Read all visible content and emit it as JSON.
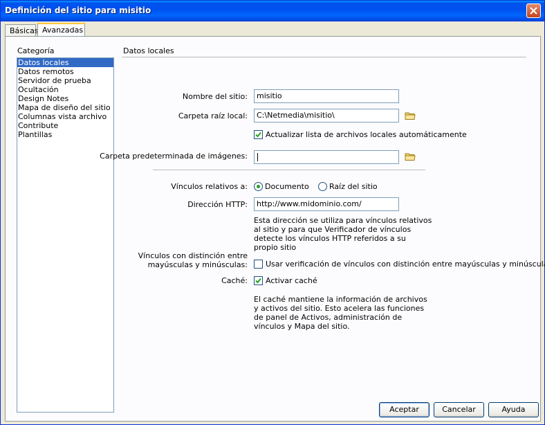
{
  "window": {
    "title": "Definición del sitio para misitio"
  },
  "tabs": [
    {
      "label": "Básicas"
    },
    {
      "label": "Avanzadas"
    }
  ],
  "category": {
    "label": "Categoría",
    "items": [
      "Datos locales",
      "Datos remotos",
      "Servidor de prueba",
      "Ocultación",
      "Design Notes",
      "Mapa de diseño del sitio",
      "Columnas vista archivo",
      "Contribute",
      "Plantillas"
    ],
    "selected": "Datos locales"
  },
  "section": {
    "title": "Datos locales"
  },
  "form": {
    "site_name_label": "Nombre del sitio:",
    "site_name_value": "misitio",
    "root_folder_label": "Carpeta raíz local:",
    "root_folder_value": "C:\\Netmedia\\misitio\\",
    "auto_refresh_label": "Actualizar lista de archivos locales automáticamente",
    "auto_refresh_checked": true,
    "images_folder_label": "Carpeta predeterminada de imágenes:",
    "images_folder_value": "",
    "relative_links_label": "Vínculos relativos a:",
    "radio_document_label": "Documento",
    "radio_root_label": "Raíz del sitio",
    "relative_links_selected": "Documento",
    "http_address_label": "Dirección HTTP:",
    "http_address_value": "http://www.midominio.com/",
    "http_help_lines": [
      "Esta dirección se utiliza para vínculos relativos",
      "al sitio y para que Verificador de vínculos",
      "detecte los vínculos HTTP referidos a su",
      "propio sitio"
    ],
    "case_links_label_1": "Vínculos con distinción entre",
    "case_links_label_2": "mayúsculas y minúsculas:",
    "case_links_checkbox_label": "Usar verificación de vínculos con distinción entre mayúsculas y minúsculas",
    "case_links_checked": false,
    "cache_label": "Caché:",
    "cache_checkbox_label": "Activar caché",
    "cache_checked": true,
    "cache_help_lines": [
      "El caché mantiene la información de archivos",
      "y activos del sitio. Esto acelera las funciones",
      "de panel de Activos, administración de",
      "vínculos y Mapa del sitio."
    ]
  },
  "buttons": {
    "ok": "Aceptar",
    "cancel": "Cancelar",
    "help": "Ayuda"
  },
  "colors": {
    "titlebar": "#0055ea",
    "selection": "#316ac5",
    "dialog": "#ece9d8",
    "check": "#21a121"
  },
  "icons": {
    "close": "close-icon",
    "folder": "folder-icon"
  }
}
